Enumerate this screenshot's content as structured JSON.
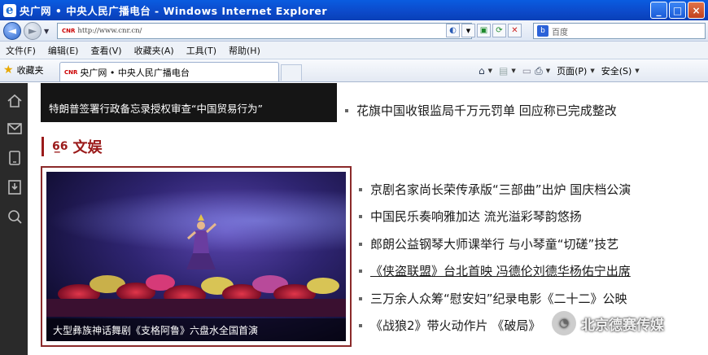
{
  "window": {
    "title": "央广网 • 中央人民广播电台 - Windows Internet Explorer"
  },
  "address": {
    "url": "http://www.cnr.cn/",
    "favicon_text": "CNR",
    "search_placeholder": "百度"
  },
  "menu": [
    "文件(F)",
    "编辑(E)",
    "查看(V)",
    "收藏夹(A)",
    "工具(T)",
    "帮助(H)"
  ],
  "favorites": {
    "label": "收藏夹",
    "tab_title": "央广网 • 中央人民广播电台"
  },
  "commandbar": {
    "page_label": "页面(P)",
    "safety_label": "安全(S)"
  },
  "content": {
    "top_caption": "特朗普签署行政备忘录授权审查“中国贸易行为”",
    "top_news": "花旗中国收银监局千万元罚单 回应称已完成整改",
    "section_title": "文娱",
    "feature_caption": "大型彝族神话舞剧《支格阿鲁》六盘水全国首演",
    "news": [
      "京剧名家尚长荣传承版“三部曲”出炉 国庆档公演",
      "中国民乐奏响雅加达 流光溢彩琴韵悠扬",
      "郎朗公益钢琴大师课举行 与小琴童“切磋”技艺",
      "《侠盗联盟》台北首映 冯德伦刘德华杨佑宁出席",
      "三万余人众筹“慰安妇”纪录电影《二十二》公映",
      "《战狼2》带火动作片 《破局》"
    ],
    "watermark": "北京德赛传媒"
  }
}
